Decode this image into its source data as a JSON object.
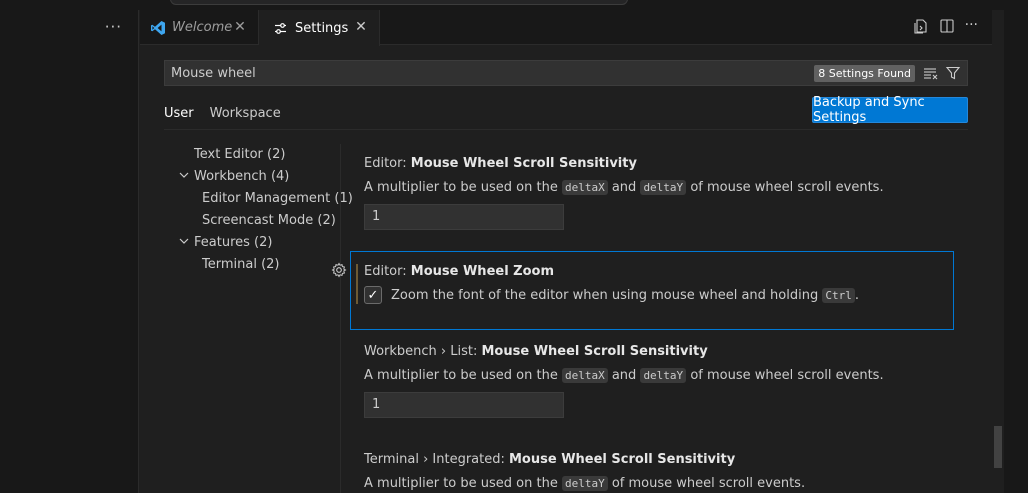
{
  "left_panel": {
    "more_label": "···"
  },
  "tabs": [
    {
      "label": "Welcome",
      "close": "✕"
    },
    {
      "label": "Settings",
      "close": "✕"
    }
  ],
  "editor_actions": {
    "more_label": "···"
  },
  "search": {
    "value": "Mouse wheel",
    "found": "8 Settings Found"
  },
  "scopes": {
    "user": "User",
    "workspace": "Workspace"
  },
  "sync_button": "Backup and Sync Settings",
  "toc": [
    {
      "label": "Text Editor",
      "count": "(2)"
    },
    {
      "label": "Workbench",
      "count": "(4)",
      "chevron": "⌵"
    },
    {
      "label": "Editor Management",
      "count": "(1)"
    },
    {
      "label": "Screencast Mode",
      "count": "(2)"
    },
    {
      "label": "Features",
      "count": "(2)",
      "chevron": "⌵"
    },
    {
      "label": "Terminal",
      "count": "(2)"
    }
  ],
  "settings": [
    {
      "category": "Editor: ",
      "name": "Mouse Wheel Scroll Sensitivity",
      "desc_pre": "A multiplier to be used on the ",
      "code1": "deltaX",
      "desc_mid": " and ",
      "code2": "deltaY",
      "desc_post": " of mouse wheel scroll events.",
      "value": "1"
    },
    {
      "category": "Editor: ",
      "name": "Mouse Wheel Zoom",
      "check_mark": "✓",
      "desc_pre": "Zoom the font of the editor when using mouse wheel and holding ",
      "code1": "Ctrl",
      "desc_post": "."
    },
    {
      "category": "Workbench › List: ",
      "name": "Mouse Wheel Scroll Sensitivity",
      "desc_pre": "A multiplier to be used on the ",
      "code1": "deltaX",
      "desc_mid": " and ",
      "code2": "deltaY",
      "desc_post": " of mouse wheel scroll events.",
      "value": "1"
    },
    {
      "category": "Terminal › Integrated: ",
      "name": "Mouse Wheel Scroll Sensitivity",
      "desc_pre": "A multiplier to be used on the ",
      "code1": "deltaY",
      "desc_post": " of mouse wheel scroll events."
    }
  ],
  "colors": {
    "accent": "#0078d4",
    "background": "#1f1f1f",
    "sidebar": "#181818"
  }
}
